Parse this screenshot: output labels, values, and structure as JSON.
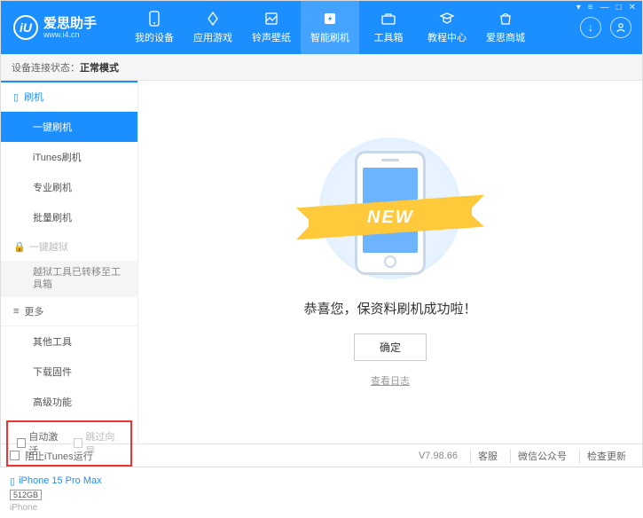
{
  "app": {
    "name": "爱思助手",
    "url": "www.i4.cn",
    "logo_letter": "iU"
  },
  "window_controls": [
    "▾",
    "≡",
    "—",
    "□",
    "✕"
  ],
  "nav": [
    {
      "label": "我的设备",
      "icon": "device"
    },
    {
      "label": "应用游戏",
      "icon": "apps"
    },
    {
      "label": "铃声壁纸",
      "icon": "ringtone"
    },
    {
      "label": "智能刷机",
      "icon": "flash",
      "active": true
    },
    {
      "label": "工具箱",
      "icon": "toolbox"
    },
    {
      "label": "教程中心",
      "icon": "tutorial"
    },
    {
      "label": "爱思商城",
      "icon": "store"
    }
  ],
  "header_buttons": {
    "download": "↓",
    "user": "👤"
  },
  "status": {
    "label": "设备连接状态：",
    "value": "正常模式"
  },
  "sidebar": {
    "flash_group": {
      "icon": "▯",
      "label": "刷机"
    },
    "flash_items": [
      "一键刷机",
      "iTunes刷机",
      "专业刷机",
      "批量刷机"
    ],
    "jailbreak": {
      "label": "一键越狱",
      "note": "越狱工具已转移至工具箱"
    },
    "more_group": {
      "icon": "≡",
      "label": "更多"
    },
    "more_items": [
      "其他工具",
      "下载固件",
      "高级功能"
    ],
    "checkboxes": {
      "auto_activate": "自动激活",
      "skip_guide": "跳过向导"
    },
    "device": {
      "name": "iPhone 15 Pro Max",
      "storage": "512GB",
      "type": "iPhone"
    }
  },
  "main": {
    "ribbon": "NEW",
    "success": "恭喜您，保资料刷机成功啦！",
    "ok": "确定",
    "log": "查看日志"
  },
  "footer": {
    "block_itunes": "阻止iTunes运行",
    "version": "V7.98.66",
    "links": [
      "客服",
      "微信公众号",
      "检查更新"
    ]
  }
}
